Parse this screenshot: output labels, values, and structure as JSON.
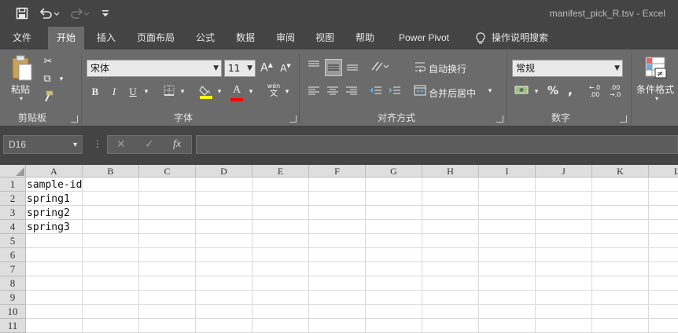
{
  "window": {
    "title": "manifest_pick_R.tsv  -  Excel"
  },
  "quick_access": [
    {
      "name": "save-icon",
      "glyph": "💾"
    },
    {
      "name": "undo-icon",
      "glyph": "↶"
    },
    {
      "name": "redo-icon",
      "glyph": "↷"
    },
    {
      "name": "customize-icon",
      "glyph": "▾"
    }
  ],
  "tabs": [
    "文件",
    "开始",
    "插入",
    "页面布局",
    "公式",
    "数据",
    "审阅",
    "视图",
    "帮助",
    "Power Pivot",
    "操作说明搜索"
  ],
  "active_tab": "开始",
  "ribbon": {
    "clipboard": {
      "paste": "粘贴",
      "label": "剪贴板"
    },
    "font": {
      "family": "宋体",
      "size": "11",
      "grow": "A",
      "shrink": "A",
      "bold": "B",
      "italic": "I",
      "underline": "U",
      "font_color": "A",
      "phonetic": "wén",
      "phonetic_char": "文",
      "label": "字体"
    },
    "alignment": {
      "wrap": "自动换行",
      "merge": "合并后居中",
      "label": "对齐方式"
    },
    "number": {
      "format": "常规",
      "percent": "%",
      "comma": ",",
      "inc_decimal": "←.0\n.00",
      "dec_decimal": ".00\n→.0",
      "label": "数字"
    },
    "styles": {
      "conditional": "条件格式"
    }
  },
  "formula_bar": {
    "name_box": "D16",
    "cancel": "✕",
    "enter": "✓",
    "fx": "fx",
    "value": ""
  },
  "grid": {
    "columns": [
      "A",
      "B",
      "C",
      "D",
      "E",
      "F",
      "G",
      "H",
      "I",
      "J",
      "K",
      "L"
    ],
    "rows": [
      "1",
      "2",
      "3",
      "4",
      "5",
      "6",
      "7",
      "8",
      "9",
      "10",
      "11"
    ],
    "cells": [
      "sample-id",
      "spring1",
      "spring2",
      "spring3"
    ]
  }
}
